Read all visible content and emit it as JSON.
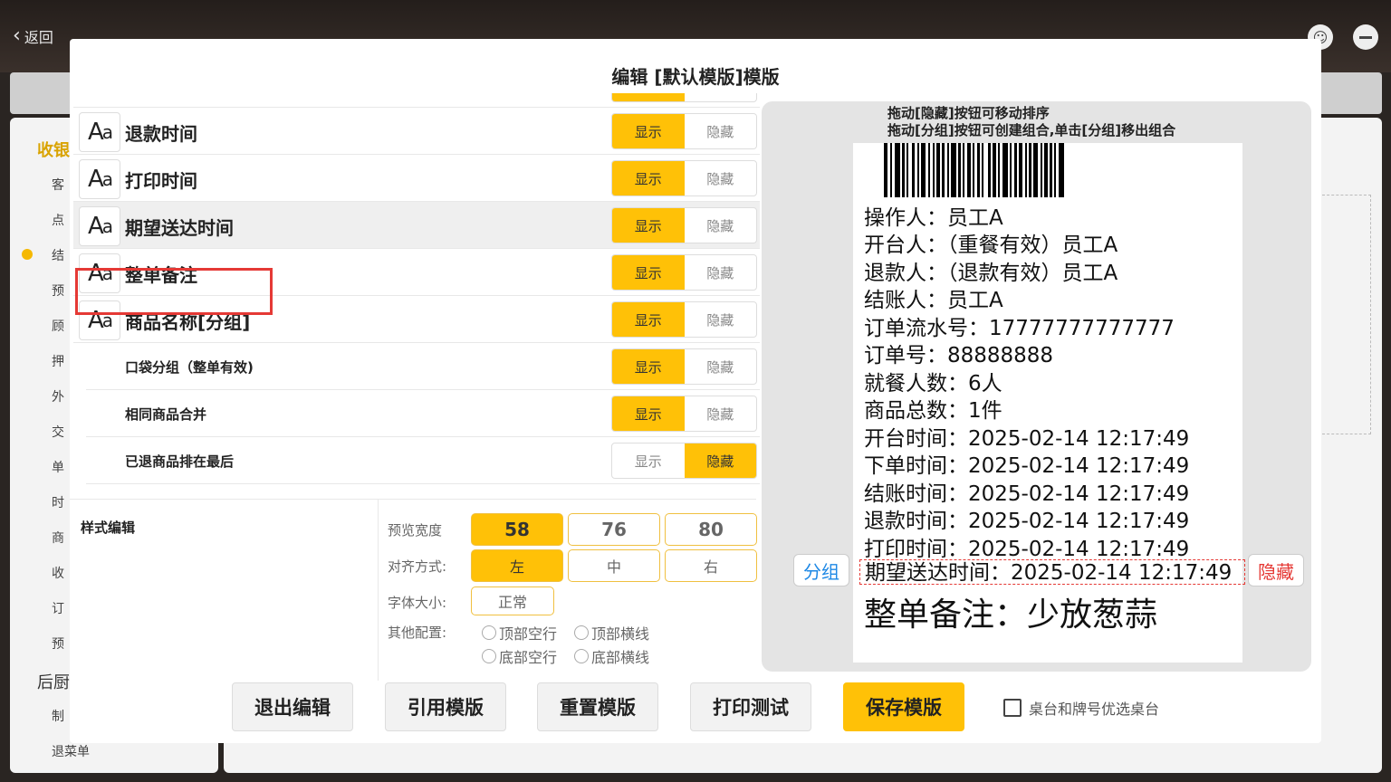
{
  "background": {
    "back_label": "返回",
    "sidebar_section1": "收银",
    "sidebar_items": [
      "客",
      "点",
      "结",
      "预",
      "顾",
      "押",
      "外",
      "交",
      "单",
      "时",
      "商",
      "收",
      "订",
      "预"
    ],
    "sidebar_section2": "后厨",
    "sidebar_items2": [
      "制",
      "退菜单"
    ]
  },
  "modal": {
    "title": "编辑 [默认模版]模版",
    "rows": [
      {
        "label": "退款时间",
        "show": "显示",
        "hide": "隐藏",
        "selected": "show"
      },
      {
        "label": "打印时间",
        "show": "显示",
        "hide": "隐藏",
        "selected": "show"
      },
      {
        "label": "期望送达时间",
        "show": "显示",
        "hide": "隐藏",
        "selected": "show"
      },
      {
        "label": "整单备注",
        "show": "显示",
        "hide": "隐藏",
        "selected": "show"
      },
      {
        "label": "商品名称[分组]",
        "show": "显示",
        "hide": "隐藏",
        "selected": "show"
      },
      {
        "label": "口袋分组（整单有效)",
        "show": "显示",
        "hide": "隐藏",
        "selected": "show"
      },
      {
        "label": "相同商品合并",
        "show": "显示",
        "hide": "隐藏",
        "selected": "show"
      },
      {
        "label": "已退商品排在最后",
        "show": "显示",
        "hide": "隐藏",
        "selected": "hide"
      }
    ],
    "style_edit": {
      "title": "样式编辑",
      "preview_width_label": "预览宽度",
      "preview_widths": [
        "58",
        "76",
        "80"
      ],
      "align_label": "对齐方式:",
      "aligns": [
        "左",
        "中",
        "右"
      ],
      "font_size_label": "字体大小:",
      "font_size_value": "正常",
      "other_label": "其他配置:",
      "other_options": [
        "顶部空行",
        "顶部横线",
        "底部空行",
        "底部横线"
      ]
    },
    "preview": {
      "hint1": "拖动[隐藏]按钮可移动排序",
      "hint2": "拖动[分组]按钮可创建组合,单击[分组]移出组合",
      "lines": [
        "操作人：员工A",
        "开台人：（重餐有效）员工A",
        "退款人：（退款有效）员工A",
        "结账人：员工A",
        "订单流水号：17777777777777",
        "订单号：88888888",
        "就餐人数：6人",
        "商品总数：1件",
        "开台时间：2025-02-14 12:17:49",
        "下单时间：2025-02-14 12:17:49",
        "结账时间：2025-02-14 12:17:49",
        "退款时间：2025-02-14 12:17:49",
        "打印时间：2025-02-14 12:17:49"
      ],
      "selected_line": "期望送达时间：2025-02-14 12:17:49",
      "remark_line": "整单备注：少放葱蒜",
      "group_tag": "分组",
      "hide_tag": "隐藏"
    },
    "footer": {
      "exit": "退出编辑",
      "use_template": "引用模版",
      "reset": "重置模版",
      "print_test": "打印测试",
      "save": "保存模版",
      "checkbox_label": "桌台和牌号优选桌台"
    }
  }
}
